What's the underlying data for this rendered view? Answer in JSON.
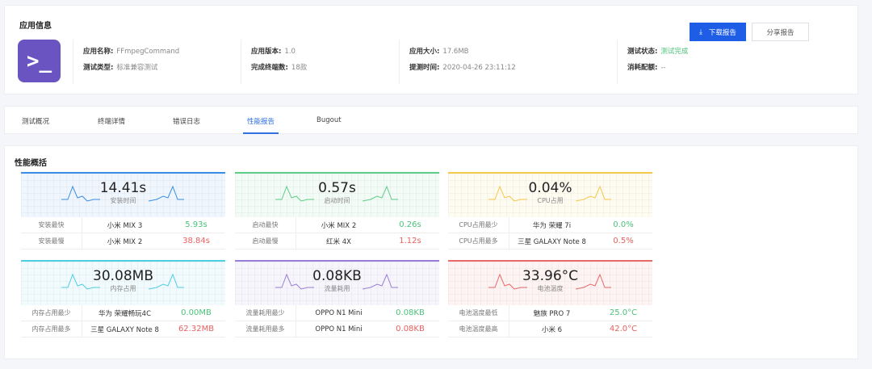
{
  "info": {
    "title": "应用信息",
    "logo_glyph": ">_",
    "fields": [
      {
        "label": "应用名称:",
        "value": "FFmpegCommand"
      },
      {
        "label": "测试类型:",
        "value": "标准兼容测试"
      },
      {
        "label": "应用版本:",
        "value": "1.0"
      },
      {
        "label": "完成终端数:",
        "value": "18款"
      },
      {
        "label": "应用大小:",
        "value": "17.6MB"
      },
      {
        "label": "提测时间:",
        "value": "2020-04-26 23:11:12"
      },
      {
        "label": "测试状态:",
        "value": "测试完成"
      },
      {
        "label": "消耗配额:",
        "value": "--"
      }
    ],
    "download": "下载报告",
    "share": "分享报告"
  },
  "tabs": [
    "测试概况",
    "终端详情",
    "错误日志",
    "性能报告",
    "Bugout"
  ],
  "perf": {
    "title": "性能概括",
    "metrics": [
      {
        "value": "14.41s",
        "label": "安装时间",
        "color": "#3a8ee6",
        "rows": [
          {
            "k": "安装最快",
            "d": "小米 MIX 3",
            "v": "5.93s"
          },
          {
            "k": "安装最慢",
            "d": "小米 MIX 2",
            "v": "38.84s"
          }
        ]
      },
      {
        "value": "0.57s",
        "label": "启动时间",
        "color": "#5fce8a",
        "rows": [
          {
            "k": "启动最快",
            "d": "小米 MIX 2",
            "v": "0.26s"
          },
          {
            "k": "启动最慢",
            "d": "红米 4X",
            "v": "1.12s"
          }
        ]
      },
      {
        "value": "0.04%",
        "label": "CPU占用",
        "color": "#f5c94c",
        "rows": [
          {
            "k": "CPU占用最少",
            "d": "华为 荣耀 7i",
            "v": "0.0%"
          },
          {
            "k": "CPU占用最多",
            "d": "三星 GALAXY Note 8",
            "v": "0.5%"
          }
        ]
      },
      {
        "value": "30.08MB",
        "label": "内存占用",
        "color": "#4dd0e1",
        "rows": [
          {
            "k": "内存占用最少",
            "d": "华为 荣耀畅玩4C",
            "v": "0.00MB"
          },
          {
            "k": "内存占用最多",
            "d": "三星 GALAXY Note 8",
            "v": "62.32MB"
          }
        ]
      },
      {
        "value": "0.08KB",
        "label": "流量耗用",
        "color": "#9a7fd6",
        "rows": [
          {
            "k": "流量耗用最少",
            "d": "OPPO N1 Mini",
            "v": "0.08KB"
          },
          {
            "k": "流量耗用最多",
            "d": "OPPO N1 Mini",
            "v": "0.08KB"
          }
        ]
      },
      {
        "value": "33.96°C",
        "label": "电池温度",
        "color": "#e86a6a",
        "rows": [
          {
            "k": "电池温度最低",
            "d": "魅族 PRO 7",
            "v": "25.0°C"
          },
          {
            "k": "电池温度最高",
            "d": "小米 6",
            "v": "42.0°C"
          }
        ]
      }
    ]
  }
}
